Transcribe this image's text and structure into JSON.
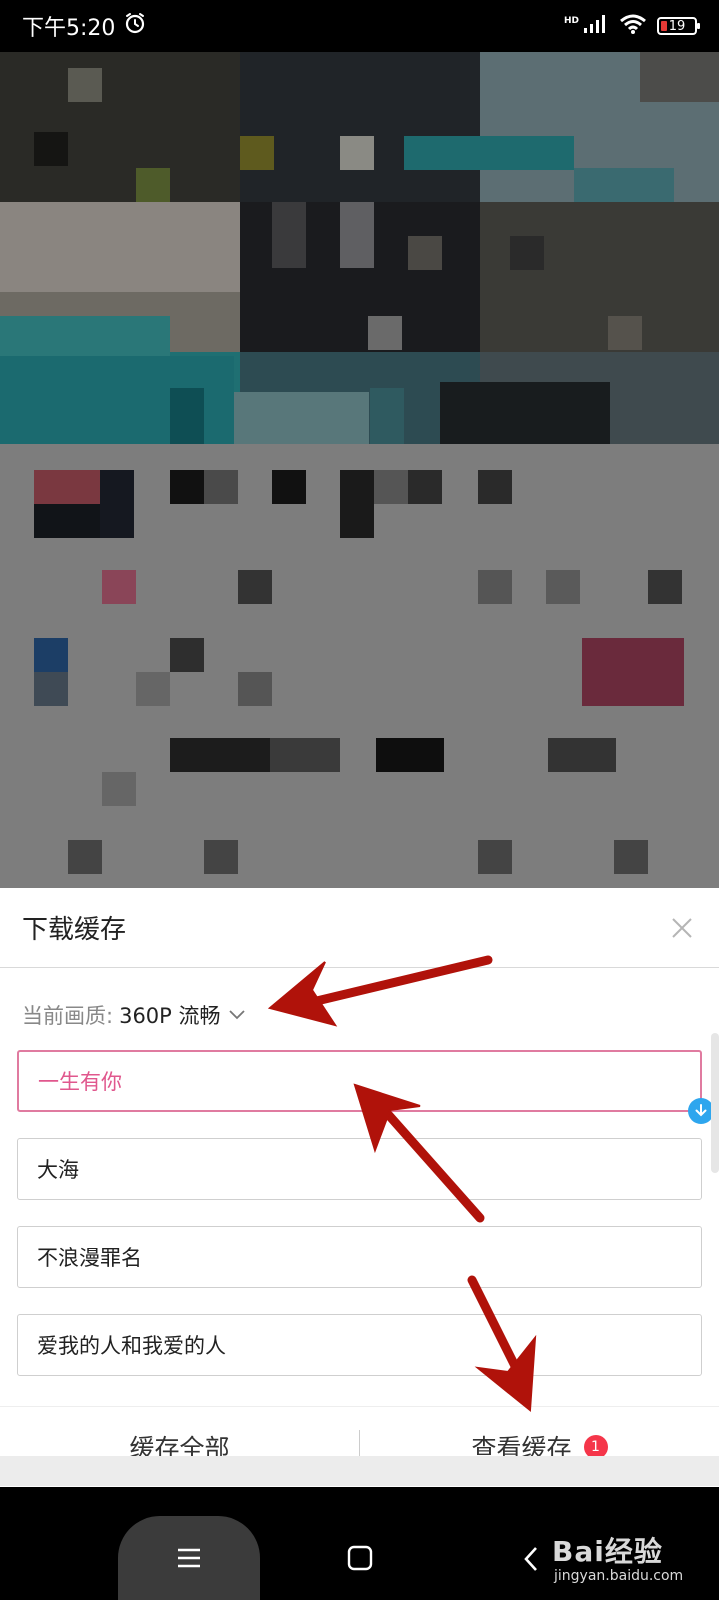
{
  "status_bar": {
    "time": "下午5:20",
    "network_label": "HD",
    "battery_level": "19"
  },
  "icons": {
    "alarm": "alarm-icon",
    "signal": "signal-icon",
    "wifi": "wifi-icon",
    "battery": "battery-icon",
    "close": "close-icon",
    "chevron": "chevron-down-icon",
    "download": "download-icon",
    "menu": "menu-icon",
    "home": "home-icon",
    "back": "back-icon"
  },
  "sheet": {
    "title": "下载缓存",
    "quality_label": "当前画质:",
    "quality_value": "360P 流畅",
    "songs": [
      {
        "title": "一生有你",
        "selected": true
      },
      {
        "title": "大海",
        "selected": false
      },
      {
        "title": "不浪漫罪名",
        "selected": false
      },
      {
        "title": "爱我的人和我爱的人",
        "selected": false
      }
    ],
    "cache_all_label": "缓存全部",
    "view_cache_label": "查看缓存",
    "view_cache_count": "1"
  },
  "watermark": {
    "brand": "Bai经验",
    "url": "jingyan.baidu.com"
  },
  "colors": {
    "selected_border": "#e07ba0",
    "selected_text": "#e0578d",
    "badge_red": "#f5364a",
    "download_blue": "#2ea6ee",
    "arrow_red": "#b0120a"
  }
}
